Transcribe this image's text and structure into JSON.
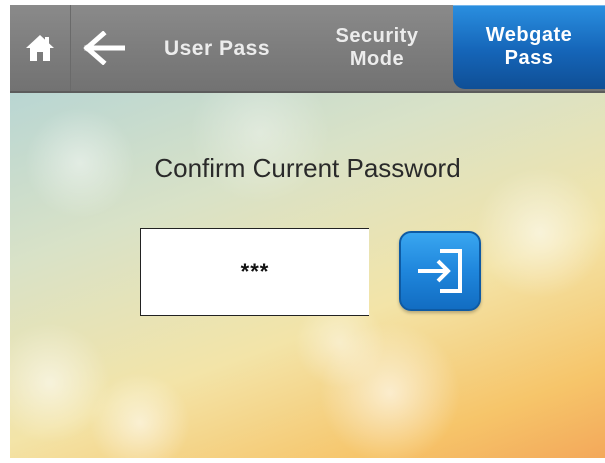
{
  "header": {
    "home_icon": "home-icon",
    "back_icon": "arrow-left-icon",
    "tabs": [
      {
        "label": "User Pass",
        "active": false
      },
      {
        "label": "Security\nMode",
        "active": false
      },
      {
        "label": "Webgate\nPass",
        "active": true
      }
    ],
    "active_color": "#1a6fc4"
  },
  "main": {
    "prompt": "Confirm Current Password",
    "password_value": "***",
    "enter_icon": "sign-in-icon",
    "enter_button_color": "#2189dc"
  }
}
